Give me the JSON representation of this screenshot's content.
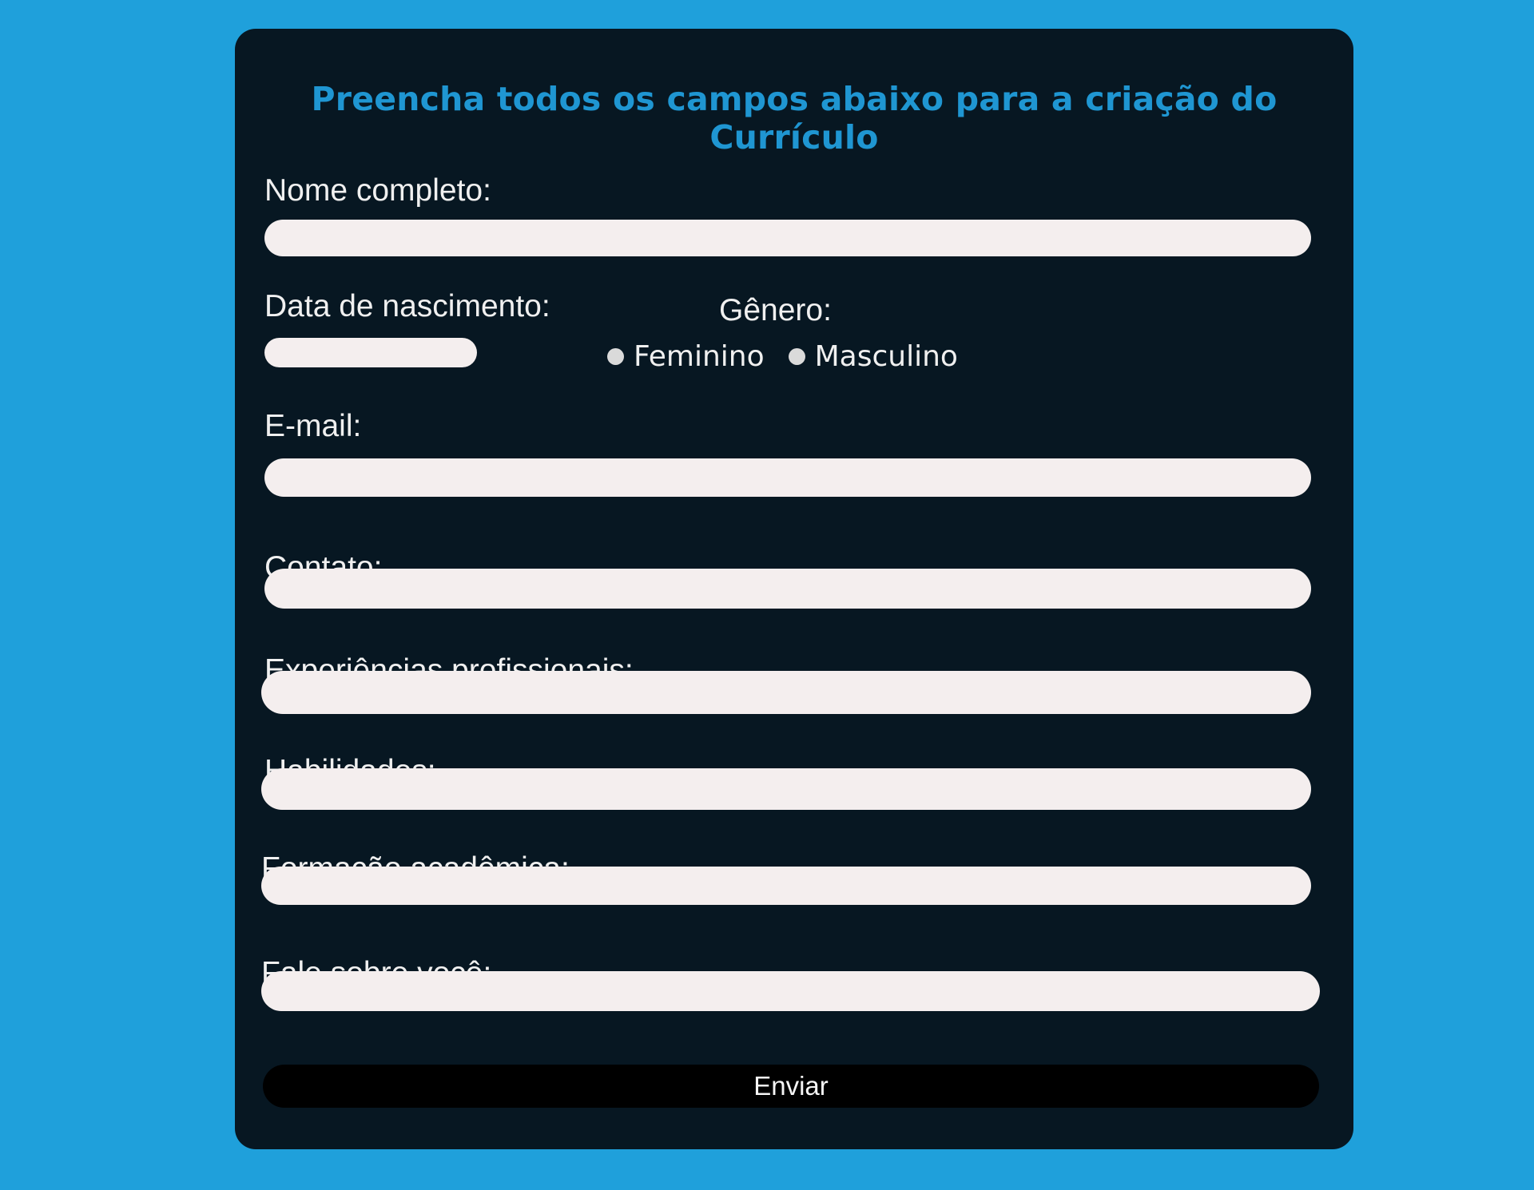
{
  "form": {
    "title": "Preencha todos os campos abaixo para a criação do Currículo",
    "full_name_label": "Nome completo:",
    "full_name_value": "",
    "birth_date_label": "Data de nascimento:",
    "birth_date_value": "",
    "gender_label": "Gênero:",
    "gender_options": [
      "Feminino",
      "Masculino"
    ],
    "email_label": "E-mail:",
    "email_value": "",
    "contact_label": "Contato:",
    "contact_value": "",
    "experience_label": "Experiências profissionais:",
    "experience_value": "",
    "skills_label": "Habilidades:",
    "skills_value": "",
    "education_label": "Formação acadêmica:",
    "education_value": "",
    "about_label": "Fale sobre você:",
    "about_value": "",
    "submit_label": "Enviar"
  },
  "colors": {
    "page_background": "#1fa0db",
    "card_background": "#071722",
    "title": "#1f96d2",
    "input_background": "#f4eeee",
    "button_background": "#000000"
  }
}
